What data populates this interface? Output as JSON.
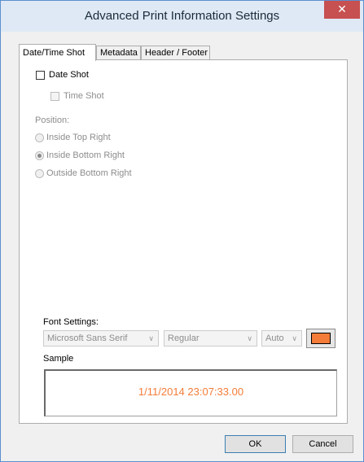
{
  "window": {
    "title": "Advanced Print Information Settings",
    "close_glyph": "✕"
  },
  "tabs": [
    {
      "label": "Date/Time Shot",
      "active": true
    },
    {
      "label": "Metadata",
      "active": false
    },
    {
      "label": "Header / Footer",
      "active": false
    }
  ],
  "datetime": {
    "date_shot": {
      "label": "Date Shot",
      "checked": false
    },
    "time_shot": {
      "label": "Time Shot",
      "checked": false,
      "enabled": false
    },
    "position_label": "Position:",
    "positions": [
      {
        "label": "Inside Top Right",
        "selected": false
      },
      {
        "label": "Inside Bottom Right",
        "selected": true
      },
      {
        "label": "Outside Bottom Right",
        "selected": false
      }
    ]
  },
  "font_settings": {
    "label": "Font Settings:",
    "font": "Microsoft Sans Serif",
    "style": "Regular",
    "size": "Auto",
    "color": "#f47c38"
  },
  "sample": {
    "label": "Sample",
    "text": "1/11/2014 23:07:33.00"
  },
  "buttons": {
    "ok": "OK",
    "cancel": "Cancel"
  },
  "colors": {
    "accent_border": "#5a8fd0",
    "close_button": "#c75050",
    "sample_text": "#f47c38"
  }
}
